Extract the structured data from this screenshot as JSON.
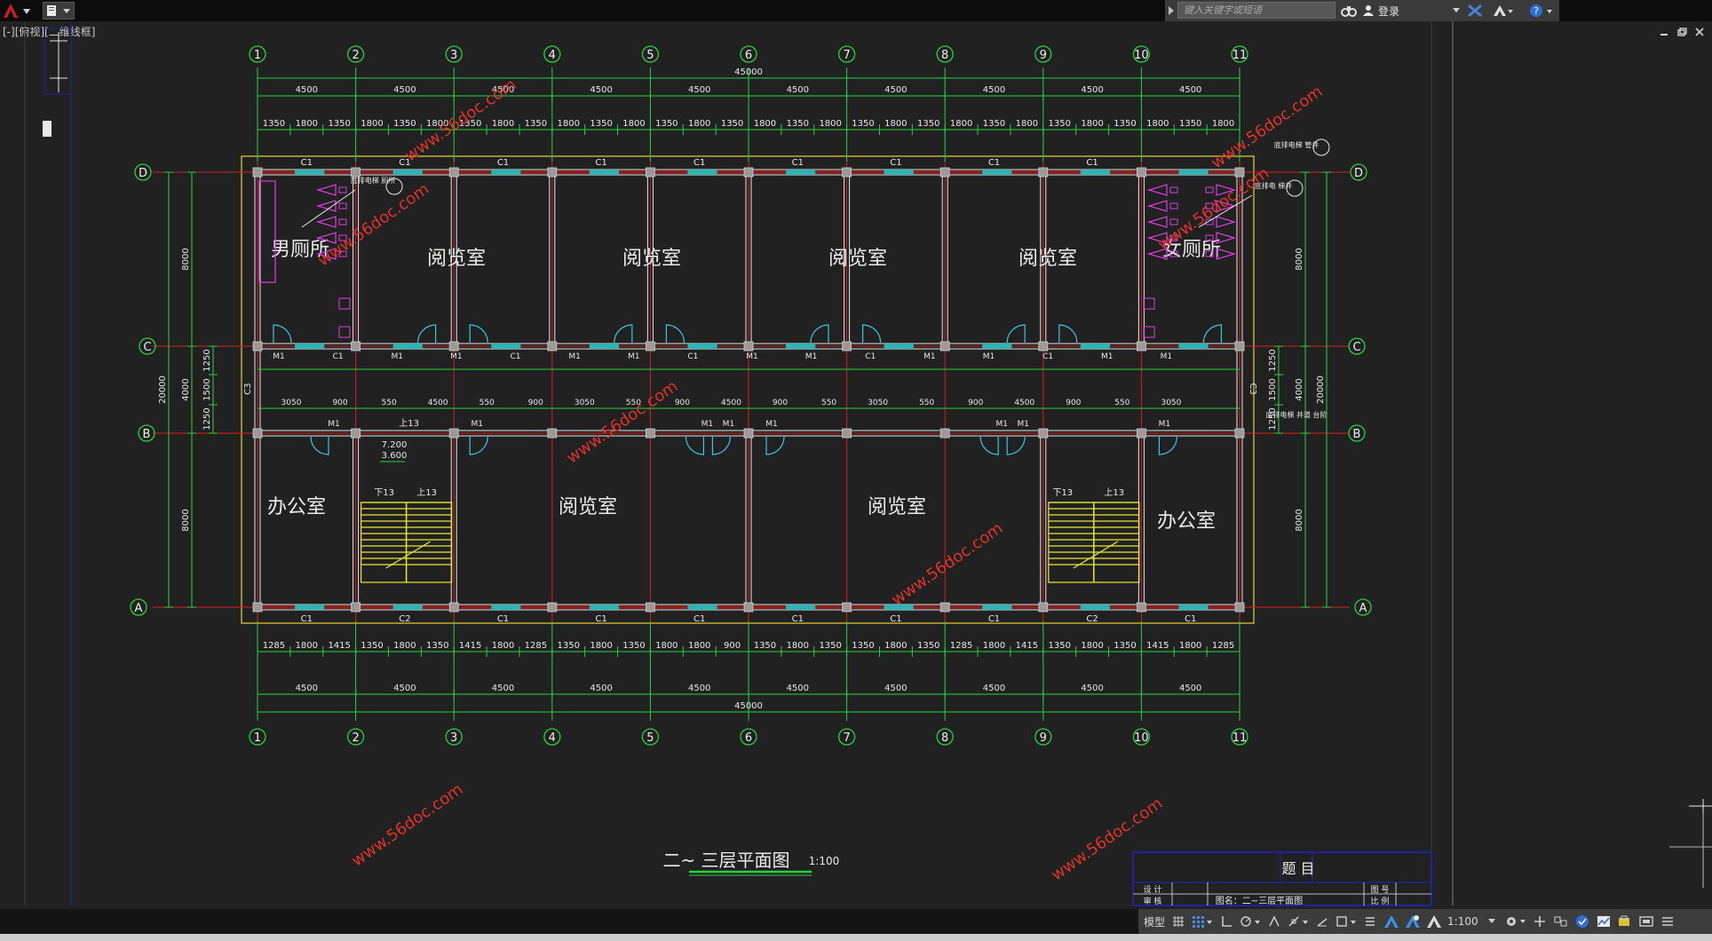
{
  "app": {
    "search_placeholder": "键入关键字或短语",
    "login_label": "登录",
    "view_label": "[-][俯视][二维线框]"
  },
  "drawing": {
    "axes_columns": [
      "1",
      "2",
      "3",
      "4",
      "5",
      "6",
      "7",
      "8",
      "9",
      "10",
      "11"
    ],
    "axes_rows": [
      "D",
      "C",
      "B",
      "A"
    ],
    "total_length": "45000",
    "bay_dims": [
      "4500",
      "4500",
      "4500",
      "4500",
      "4500",
      "4500",
      "4500",
      "4500",
      "4500",
      "4500"
    ],
    "top_detail_dims": [
      "1350",
      "1800",
      "1350",
      "1800",
      "1350",
      "1800",
      "1350",
      "1800",
      "1350",
      "1800",
      "1350",
      "1800",
      "1350",
      "1800",
      "1350",
      "1800",
      "1350",
      "1800",
      "1350",
      "1800",
      "1350",
      "1800",
      "1350",
      "1800",
      "1350",
      "1800",
      "1350",
      "1800",
      "1350",
      "1800"
    ],
    "bottom_detail_dims": [
      "1285",
      "1800",
      "1415",
      "1350",
      "1800",
      "1350",
      "1415",
      "1800",
      "1285",
      "1350",
      "1800",
      "1350",
      "1800",
      "1800",
      "900",
      "1350",
      "1800",
      "1350",
      "1350",
      "1800",
      "1350",
      "1285",
      "1800",
      "1415",
      "1350",
      "1800",
      "1350",
      "1415",
      "1800",
      "1285"
    ],
    "top_windows": [
      "C1",
      "C1",
      "C1",
      "C1",
      "C1",
      "C1",
      "C1",
      "C1",
      "C1"
    ],
    "bottom_windows": [
      "C1",
      "C2",
      "C1",
      "C1",
      "C1",
      "C1",
      "C1",
      "C1",
      "C2",
      "C1"
    ],
    "left_dims_outer": "20000",
    "left_dims_inner": [
      "8000",
      "4000",
      "8000"
    ],
    "corridor_dims": [
      "1250",
      "1500",
      "1250"
    ],
    "rooms_top": [
      "男厕所",
      "阅览室",
      "阅览室",
      "阅览室",
      "阅览室",
      "女厕所"
    ],
    "rooms_bottom": [
      "办公室",
      "阅览室",
      "阅览室",
      "办公室"
    ],
    "stair_labels": [
      "下13",
      "上13",
      "下13",
      "上13"
    ],
    "level_label_1": "7.200",
    "level_label_2": "3.600",
    "door_label": "M1",
    "corridor_window_label": "C3",
    "corridor_upper_dims": [
      "M1",
      "C1",
      "M1",
      "M1",
      "C1",
      "M1",
      "M1",
      "C1",
      "M1",
      "M1",
      "C1",
      "M1",
      "M1",
      "C1",
      "M1",
      "M1"
    ],
    "corridor_lower_dims": [
      "3050",
      "900",
      "550",
      "4500",
      "550",
      "900",
      "3050",
      "550",
      "900",
      "4500",
      "900",
      "550",
      "3050",
      "550",
      "900",
      "4500",
      "900",
      "550",
      "3050"
    ],
    "title": "二~ 三层平面图",
    "scale": "1:100",
    "watermark": "www.56doc.com",
    "tag_left_top": "底排电梯 厕所",
    "tag_right_top": "底排电梯 管井",
    "tag_right_top2": "底排电 梯井",
    "tag_right_mid": "底排电梯 井道 台阶",
    "titleblock_heading": "题 目",
    "titleblock_row1_label": "设 计",
    "titleblock_row2_label": "审 核",
    "titleblock_name": "图名：二~三层平面图",
    "titleblock_r1": "图 号",
    "titleblock_r2": "比 例"
  },
  "status": {
    "model_tab": "模型",
    "scale": "1:100"
  },
  "colors": {
    "grid_green": "#27d23f",
    "axis_red": "#d61e1e",
    "wall_white": "#e8e8e8",
    "window_cyan": "#2fb3b3",
    "door_cyan": "#38c8e6",
    "fixture_magenta": "#e03ce0",
    "stair_yellow": "#e8e83a",
    "outline_yellow": "#e8d23a",
    "watermark_red": "#e0322a",
    "title_blue": "#2323c8"
  }
}
